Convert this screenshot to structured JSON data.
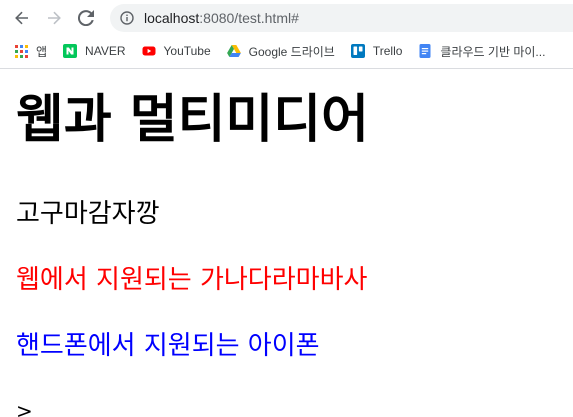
{
  "browser": {
    "url_host": "localhost",
    "url_rest": ":8080/test.html#",
    "bookmarks": [
      {
        "label": "앱",
        "icon": "apps-grid-icon"
      },
      {
        "label": "NAVER",
        "icon": "naver-icon"
      },
      {
        "label": "YouTube",
        "icon": "youtube-icon"
      },
      {
        "label": "Google 드라이브",
        "icon": "google-drive-icon"
      },
      {
        "label": "Trello",
        "icon": "trello-icon"
      },
      {
        "label": "클라우드 기반 마이...",
        "icon": "docs-icon"
      }
    ]
  },
  "page": {
    "title": "웹과 멀티미디어",
    "line1": "고구마감자깡",
    "line2": {
      "text": "웹에서 지원되는 가나다라마바사",
      "color": "#ff0000"
    },
    "line3": {
      "text": "핸드폰에서 지원되는 아이폰",
      "color": "#0000ff"
    },
    "line4": ">"
  },
  "colors": {
    "naver": "#03c75a",
    "youtube": "#ff0000",
    "trello": "#0079bf",
    "docs": "#4285f4"
  }
}
